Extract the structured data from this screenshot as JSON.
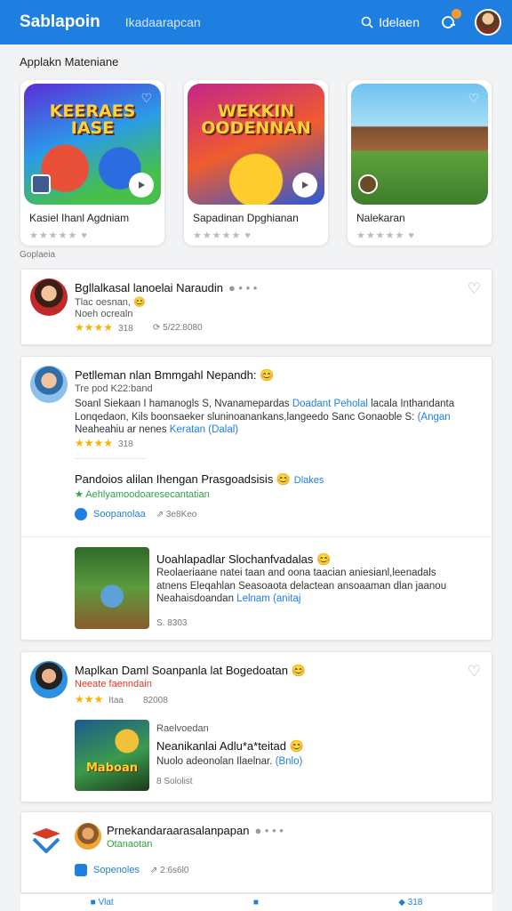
{
  "header": {
    "brand": "Sablapoin",
    "subtitle": "Ikadaarapcan",
    "search_label": "Idelaen",
    "colors": {
      "bar": "#1f7fe0",
      "notif_dot": "#f79a2a"
    },
    "icons": [
      "search-icon",
      "notification-icon",
      "avatar"
    ]
  },
  "section": {
    "title": "Applakn Mateniane",
    "small_label": "Goplaeia"
  },
  "apps": [
    {
      "title_art": "KEERAES IASE",
      "name": "Kasiel Ihanl Agdniam",
      "rating": "★★★★★ ♥"
    },
    {
      "title_art": "WEKKIN OODENNAN",
      "name": "Sapadinan Dpghianan",
      "rating": "★★★★★ ♥"
    },
    {
      "title_art": "",
      "name": "Nalekaran",
      "rating": "★★★★★ ♥"
    }
  ],
  "posts": [
    {
      "title": "Bgllalkasal lanoelai Naraudin",
      "sub1": "Tlac oesnan, 😊",
      "sub2": "Noeh ocrealn",
      "stars": "★★★★",
      "score": "318",
      "meta": "5/22:8080"
    },
    {
      "title": "Petlleman nlan Bmmgahl Nepandh: 😊",
      "sub1": "Tre pod K22:band",
      "body": "Soanl Siekaan I hamanogls S, Nvanamepardas",
      "body_link1": "Doadant Peholal",
      "body_mid": "lacala Inthandanta Lonqedaon, Kils boonsaeker sluninoanankans,langeedo Sanc Gonaoble S:",
      "body_link2": "(Angan",
      "body_end": "Neaheahiu ar nenes",
      "body_link3": "Keratan (Dalal)",
      "stars": "★★★★",
      "score": "318",
      "sub_title": "Pandoios alilan Ihengan Prasgoadsisis 😊",
      "sub_badge": "Dlakes",
      "sub_green": "★ Aehlyamoodoaresecantatian",
      "share_label": "Soopanolaa",
      "share_meta": "⇗ 3e8Keo",
      "game_title": "Uoahlapadlar Slochanfvadalas 😊",
      "game_body": "Reolaeriaane natei taan and oona taacian aniesianl,leenadals atnens Eleqahlan Seasoaota delactean ansoaaman dlan jaanou Neahaisdoandan",
      "game_link": "Lelnam (anitaj",
      "game_meta": "S. 8303"
    },
    {
      "title": "Maplkan Daml Soanpanla lat Bogedoatan 😊",
      "red": "Neeate faenndain",
      "stars": "★★★",
      "star_label": "Itaa",
      "score": "82008",
      "game_sub": "Raelvoedan",
      "game_title": "Neanikanlai Adlu*a*teitad 😊",
      "game_body": "Nuolo adeonolan Ilaelnar.",
      "game_link": "(Bnlo)",
      "game_meta": "8 Sololist",
      "thumb_label": "Maboan"
    },
    {
      "title": "Prnekandaraarasalanpapan",
      "green": "Otanaotan",
      "share_label": "Sopenoles",
      "share_meta": "⇗ 2:6s6l0"
    }
  ],
  "bottom": {
    "items": [
      "Vlat",
      "",
      "318"
    ]
  }
}
